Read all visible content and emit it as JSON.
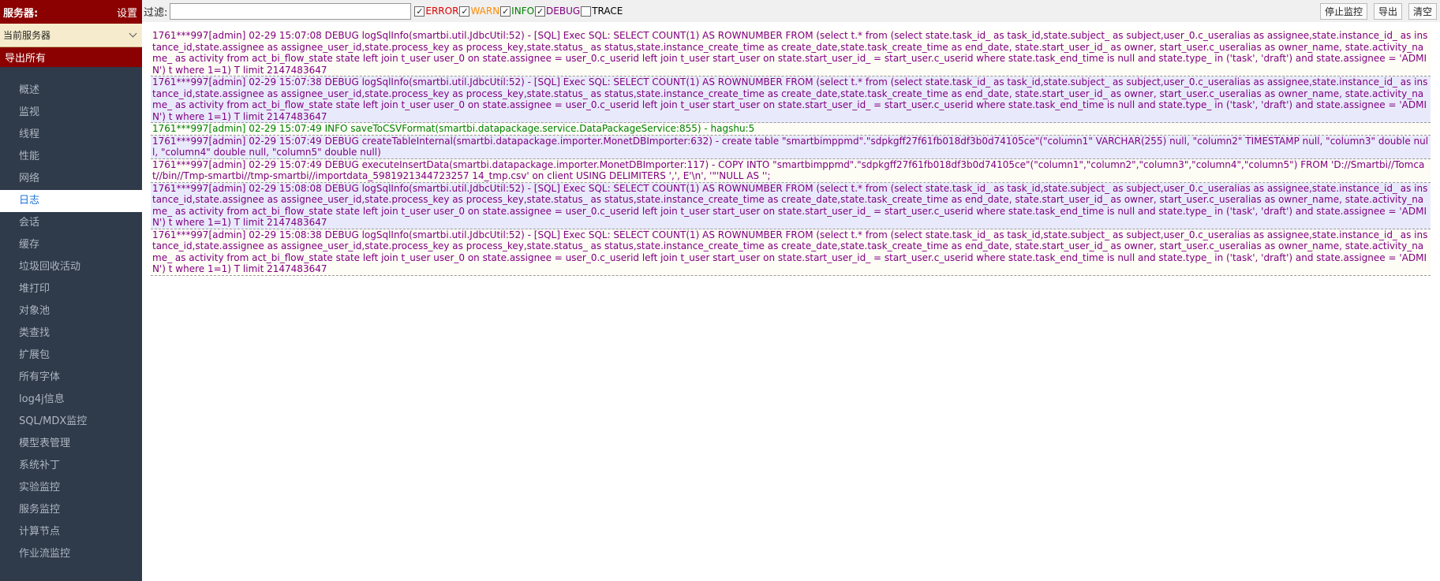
{
  "sidebar": {
    "title": "服务器:",
    "settings": "设置",
    "server_select": "当前服务器",
    "export_all": "导出所有",
    "items": [
      {
        "label": "概述"
      },
      {
        "label": "监视"
      },
      {
        "label": "线程"
      },
      {
        "label": "性能"
      },
      {
        "label": "网络"
      },
      {
        "label": "日志"
      },
      {
        "label": "会话"
      },
      {
        "label": "缓存"
      },
      {
        "label": "垃圾回收活动"
      },
      {
        "label": "堆打印"
      },
      {
        "label": "对象池"
      },
      {
        "label": "类查找"
      },
      {
        "label": "扩展包"
      },
      {
        "label": "所有字体"
      },
      {
        "label": "log4j信息"
      },
      {
        "label": "SQL/MDX监控"
      },
      {
        "label": "模型表管理"
      },
      {
        "label": "系统补丁"
      },
      {
        "label": "实验监控"
      },
      {
        "label": "服务监控"
      },
      {
        "label": "计算节点"
      },
      {
        "label": "作业流监控"
      }
    ],
    "active_item": "日志"
  },
  "toolbar": {
    "filter_label": "过滤:",
    "filter_value": "",
    "levels": [
      {
        "label": "ERROR",
        "checked": true,
        "color": "#e00000"
      },
      {
        "label": "WARN",
        "checked": true,
        "color": "#ff8c00"
      },
      {
        "label": "INFO",
        "checked": true,
        "color": "#008000"
      },
      {
        "label": "DEBUG",
        "checked": true,
        "color": "#800080"
      },
      {
        "label": "TRACE",
        "checked": false,
        "color": "#000000"
      }
    ],
    "stop_button": "停止监控",
    "export_button": "导出",
    "clear_button": "清空"
  },
  "log": {
    "entries": [
      {
        "level": "debug",
        "text": "1761***997[admin] 02-29 15:07:08 DEBUG logSqlInfo(smartbi.util.JdbcUtil:52) - [SQL] Exec SQL: SELECT COUNT(1) AS ROWNUMBER FROM (select t.* from (select state.task_id_ as task_id,state.subject_ as subject,user_0.c_useralias as assignee,state.instance_id_ as instance_id,state.assignee as assignee_user_id,state.process_key as process_key,state.status_ as status,state.instance_create_time as create_date,state.task_create_time as end_date, state.start_user_id_ as owner, start_user.c_useralias as owner_name, state.activity_name_ as activity from act_bi_flow_state state left join t_user user_0 on state.assignee = user_0.c_userid left join t_user start_user on state.start_user_id_ = start_user.c_userid where state.task_end_time is null and state.type_ in ('task', 'draft') and state.assignee = 'ADMIN') t where 1=1) T limit 2147483647"
      },
      {
        "level": "debug",
        "text": "1761***997[admin] 02-29 15:07:38 DEBUG logSqlInfo(smartbi.util.JdbcUtil:52) - [SQL] Exec SQL: SELECT COUNT(1) AS ROWNUMBER FROM (select t.* from (select state.task_id_ as task_id,state.subject_ as subject,user_0.c_useralias as assignee,state.instance_id_ as instance_id,state.assignee as assignee_user_id,state.process_key as process_key,state.status_ as status,state.instance_create_time as create_date,state.task_create_time as end_date, state.start_user_id_ as owner, start_user.c_useralias as owner_name, state.activity_name_ as activity from act_bi_flow_state state left join t_user user_0 on state.assignee = user_0.c_userid left join t_user start_user on state.start_user_id_ = start_user.c_userid where state.task_end_time is null and state.type_ in ('task', 'draft') and state.assignee = 'ADMIN') t where 1=1) T limit 2147483647"
      },
      {
        "level": "info",
        "text": "1761***997[admin] 02-29 15:07:49 INFO saveToCSVFormat(smartbi.datapackage.service.DataPackageService:855) - hagshu:5"
      },
      {
        "level": "debug",
        "text": "1761***997[admin] 02-29 15:07:49 DEBUG createTableInternal(smartbi.datapackage.importer.MonetDBImporter:632) - create table \"smartbimppmd\".\"sdpkgff27f61fb018df3b0d74105ce\"(\"column1\" VARCHAR(255) null, \"column2\" TIMESTAMP null, \"column3\" double null, \"column4\" double null, \"column5\" double null)"
      },
      {
        "level": "debug",
        "text": "1761***997[admin] 02-29 15:07:49 DEBUG executeInsertData(smartbi.datapackage.importer.MonetDBImporter:117) - COPY INTO \"smartbimppmd\".\"sdpkgff27f61fb018df3b0d74105ce\"(\"column1\",\"column2\",\"column3\",\"column4\",\"column5\") FROM 'D://Smartbi//Tomcat//bin//Tmp-smartbi//tmp-smartbi//importdata_5981921344723257 14_tmp.csv' on client USING DELIMITERS ',', E'\\n', '\"'NULL AS '';"
      },
      {
        "level": "debug",
        "text": "1761***997[admin] 02-29 15:08:08 DEBUG logSqlInfo(smartbi.util.JdbcUtil:52) - [SQL] Exec SQL: SELECT COUNT(1) AS ROWNUMBER FROM (select t.* from (select state.task_id_ as task_id,state.subject_ as subject,user_0.c_useralias as assignee,state.instance_id_ as instance_id,state.assignee as assignee_user_id,state.process_key as process_key,state.status_ as status,state.instance_create_time as create_date,state.task_create_time as end_date, state.start_user_id_ as owner, start_user.c_useralias as owner_name, state.activity_name_ as activity from act_bi_flow_state state left join t_user user_0 on state.assignee = user_0.c_userid left join t_user start_user on state.start_user_id_ = start_user.c_userid where state.task_end_time is null and state.type_ in ('task', 'draft') and state.assignee = 'ADMIN') t where 1=1) T limit 2147483647"
      },
      {
        "level": "debug",
        "text": "1761***997[admin] 02-29 15:08:38 DEBUG logSqlInfo(smartbi.util.JdbcUtil:52) - [SQL] Exec SQL: SELECT COUNT(1) AS ROWNUMBER FROM (select t.* from (select state.task_id_ as task_id,state.subject_ as subject,user_0.c_useralias as assignee,state.instance_id_ as instance_id,state.assignee as assignee_user_id,state.process_key as process_key,state.status_ as status,state.instance_create_time as create_date,state.task_create_time as end_date, state.start_user_id_ as owner, start_user.c_useralias as owner_name, state.activity_name_ as activity from act_bi_flow_state state left join t_user user_0 on state.assignee = user_0.c_userid left join t_user start_user on state.start_user_id_ = start_user.c_userid where state.task_end_time is null and state.type_ in ('task', 'draft') and state.assignee = 'ADMIN') t where 1=1) T limit 2147483647"
      }
    ]
  }
}
